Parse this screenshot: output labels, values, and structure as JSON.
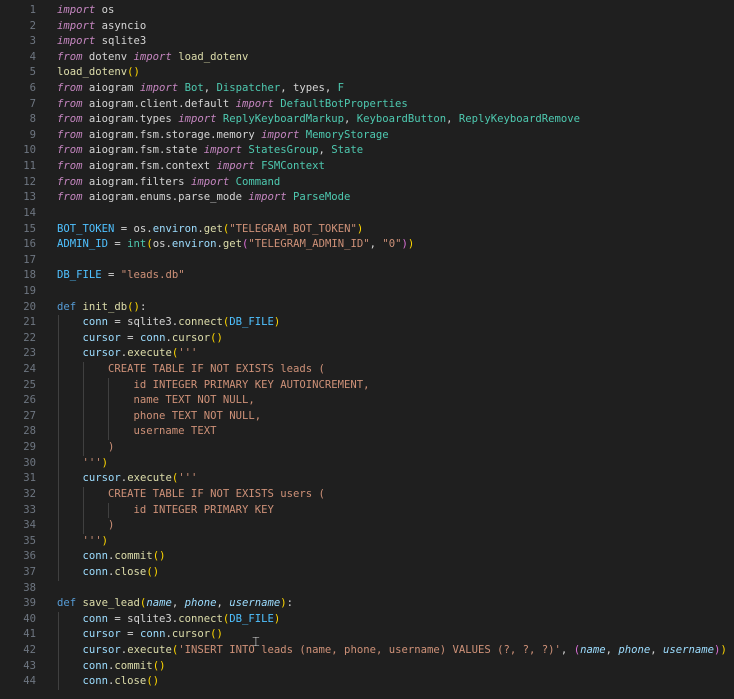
{
  "editor": {
    "language": "python",
    "colors": {
      "background": "#1f1f1f",
      "line_number": "#6e7681",
      "keyword": "#c586c0",
      "function": "#dcdcaa",
      "string": "#ce9178",
      "variable": "#9cdcfe",
      "class": "#4ec9b0"
    },
    "lines": [
      {
        "n": "1",
        "tokens": [
          [
            "kw",
            "import"
          ],
          [
            "p",
            " os"
          ]
        ]
      },
      {
        "n": "2",
        "tokens": [
          [
            "kw",
            "import"
          ],
          [
            "p",
            " asyncio"
          ]
        ]
      },
      {
        "n": "3",
        "tokens": [
          [
            "kw",
            "import"
          ],
          [
            "p",
            " sqlite3"
          ]
        ]
      },
      {
        "n": "4",
        "tokens": [
          [
            "kw",
            "from"
          ],
          [
            "p",
            " dotenv "
          ],
          [
            "kw",
            "import"
          ],
          [
            "fn",
            " load_dotenv"
          ]
        ]
      },
      {
        "n": "5",
        "tokens": [
          [
            "fn",
            "load_dotenv"
          ],
          [
            "b1",
            "()"
          ]
        ]
      },
      {
        "n": "6",
        "tokens": [
          [
            "kw",
            "from"
          ],
          [
            "p",
            " aiogram "
          ],
          [
            "kw",
            "import"
          ],
          [
            "cls",
            " Bot"
          ],
          [
            "p",
            ", "
          ],
          [
            "cls",
            "Dispatcher"
          ],
          [
            "p",
            ", types, "
          ],
          [
            "cls",
            "F"
          ]
        ]
      },
      {
        "n": "7",
        "tokens": [
          [
            "kw",
            "from"
          ],
          [
            "p",
            " aiogram.client.default "
          ],
          [
            "kw",
            "import"
          ],
          [
            "cls",
            " DefaultBotProperties"
          ]
        ]
      },
      {
        "n": "8",
        "tokens": [
          [
            "kw",
            "from"
          ],
          [
            "p",
            " aiogram.types "
          ],
          [
            "kw",
            "import"
          ],
          [
            "cls",
            " ReplyKeyboardMarkup"
          ],
          [
            "p",
            ", "
          ],
          [
            "cls",
            "KeyboardButton"
          ],
          [
            "p",
            ", "
          ],
          [
            "cls",
            "ReplyKeyboardRemove"
          ]
        ]
      },
      {
        "n": "9",
        "tokens": [
          [
            "kw",
            "from"
          ],
          [
            "p",
            " aiogram.fsm.storage.memory "
          ],
          [
            "kw",
            "import"
          ],
          [
            "cls",
            " MemoryStorage"
          ]
        ]
      },
      {
        "n": "10",
        "tokens": [
          [
            "kw",
            "from"
          ],
          [
            "p",
            " aiogram.fsm.state "
          ],
          [
            "kw",
            "import"
          ],
          [
            "cls",
            " StatesGroup"
          ],
          [
            "p",
            ", "
          ],
          [
            "cls",
            "State"
          ]
        ]
      },
      {
        "n": "11",
        "tokens": [
          [
            "kw",
            "from"
          ],
          [
            "p",
            " aiogram.fsm.context "
          ],
          [
            "kw",
            "import"
          ],
          [
            "cls",
            " FSMContext"
          ]
        ]
      },
      {
        "n": "12",
        "tokens": [
          [
            "kw",
            "from"
          ],
          [
            "p",
            " aiogram.filters "
          ],
          [
            "kw",
            "import"
          ],
          [
            "cls",
            " Command"
          ]
        ]
      },
      {
        "n": "13",
        "tokens": [
          [
            "kw",
            "from"
          ],
          [
            "p",
            " aiogram.enums.parse_mode "
          ],
          [
            "kw",
            "import"
          ],
          [
            "cls",
            " ParseMode"
          ]
        ]
      },
      {
        "n": "14",
        "tokens": []
      },
      {
        "n": "15",
        "tokens": [
          [
            "const",
            "BOT_TOKEN"
          ],
          [
            "p",
            " = os."
          ],
          [
            "var",
            "environ"
          ],
          [
            "p",
            "."
          ],
          [
            "fn",
            "get"
          ],
          [
            "b1",
            "("
          ],
          [
            "str",
            "\"TELEGRAM_BOT_TOKEN\""
          ],
          [
            "b1",
            ")"
          ]
        ]
      },
      {
        "n": "16",
        "tokens": [
          [
            "const",
            "ADMIN_ID"
          ],
          [
            "p",
            " = "
          ],
          [
            "cls",
            "int"
          ],
          [
            "b1",
            "("
          ],
          [
            "p",
            "os."
          ],
          [
            "var",
            "environ"
          ],
          [
            "p",
            "."
          ],
          [
            "fn",
            "get"
          ],
          [
            "b2",
            "("
          ],
          [
            "str",
            "\"TELEGRAM_ADMIN_ID\""
          ],
          [
            "p",
            ", "
          ],
          [
            "str",
            "\"0\""
          ],
          [
            "b2",
            ")"
          ],
          [
            "b1",
            ")"
          ]
        ]
      },
      {
        "n": "17",
        "tokens": []
      },
      {
        "n": "18",
        "tokens": [
          [
            "const",
            "DB_FILE"
          ],
          [
            "p",
            " = "
          ],
          [
            "str",
            "\"leads.db\""
          ]
        ]
      },
      {
        "n": "19",
        "tokens": []
      },
      {
        "n": "20",
        "tokens": [
          [
            "def",
            "def"
          ],
          [
            "fn",
            " init_db"
          ],
          [
            "b1",
            "()"
          ],
          [
            "p",
            ":"
          ]
        ]
      },
      {
        "n": "21",
        "tokens": [
          [
            "p",
            "    "
          ],
          [
            "var",
            "conn"
          ],
          [
            "p",
            " = sqlite3."
          ],
          [
            "fn",
            "connect"
          ],
          [
            "b1",
            "("
          ],
          [
            "const",
            "DB_FILE"
          ],
          [
            "b1",
            ")"
          ]
        ]
      },
      {
        "n": "22",
        "tokens": [
          [
            "p",
            "    "
          ],
          [
            "var",
            "cursor"
          ],
          [
            "p",
            " = "
          ],
          [
            "var",
            "conn"
          ],
          [
            "p",
            "."
          ],
          [
            "fn",
            "cursor"
          ],
          [
            "b1",
            "()"
          ]
        ]
      },
      {
        "n": "23",
        "tokens": [
          [
            "p",
            "    "
          ],
          [
            "var",
            "cursor"
          ],
          [
            "p",
            "."
          ],
          [
            "fn",
            "execute"
          ],
          [
            "b1",
            "("
          ],
          [
            "str",
            "'''"
          ]
        ]
      },
      {
        "n": "24",
        "tokens": [
          [
            "str",
            "        CREATE TABLE IF NOT EXISTS leads ("
          ]
        ]
      },
      {
        "n": "25",
        "tokens": [
          [
            "str",
            "            id INTEGER PRIMARY KEY AUTOINCREMENT,"
          ]
        ]
      },
      {
        "n": "26",
        "tokens": [
          [
            "str",
            "            name TEXT NOT NULL,"
          ]
        ]
      },
      {
        "n": "27",
        "tokens": [
          [
            "str",
            "            phone TEXT NOT NULL,"
          ]
        ]
      },
      {
        "n": "28",
        "tokens": [
          [
            "str",
            "            username TEXT"
          ]
        ]
      },
      {
        "n": "29",
        "tokens": [
          [
            "str",
            "        )"
          ]
        ]
      },
      {
        "n": "30",
        "tokens": [
          [
            "str",
            "    '''"
          ],
          [
            "b1",
            ")"
          ]
        ]
      },
      {
        "n": "31",
        "tokens": [
          [
            "p",
            "    "
          ],
          [
            "var",
            "cursor"
          ],
          [
            "p",
            "."
          ],
          [
            "fn",
            "execute"
          ],
          [
            "b1",
            "("
          ],
          [
            "str",
            "'''"
          ]
        ]
      },
      {
        "n": "32",
        "tokens": [
          [
            "str",
            "        CREATE TABLE IF NOT EXISTS users ("
          ]
        ]
      },
      {
        "n": "33",
        "tokens": [
          [
            "str",
            "            id INTEGER PRIMARY KEY"
          ]
        ]
      },
      {
        "n": "34",
        "tokens": [
          [
            "str",
            "        )"
          ]
        ]
      },
      {
        "n": "35",
        "tokens": [
          [
            "str",
            "    '''"
          ],
          [
            "b1",
            ")"
          ]
        ]
      },
      {
        "n": "36",
        "tokens": [
          [
            "p",
            "    "
          ],
          [
            "var",
            "conn"
          ],
          [
            "p",
            "."
          ],
          [
            "fn",
            "commit"
          ],
          [
            "b1",
            "()"
          ]
        ]
      },
      {
        "n": "37",
        "tokens": [
          [
            "p",
            "    "
          ],
          [
            "var",
            "conn"
          ],
          [
            "p",
            "."
          ],
          [
            "fn",
            "close"
          ],
          [
            "b1",
            "()"
          ]
        ]
      },
      {
        "n": "38",
        "tokens": []
      },
      {
        "n": "39",
        "tokens": [
          [
            "def",
            "def"
          ],
          [
            "fn",
            " save_lead"
          ],
          [
            "b1",
            "("
          ],
          [
            "prm",
            "name"
          ],
          [
            "p",
            ", "
          ],
          [
            "prm",
            "phone"
          ],
          [
            "p",
            ", "
          ],
          [
            "prm",
            "username"
          ],
          [
            "b1",
            ")"
          ],
          [
            "p",
            ":"
          ]
        ]
      },
      {
        "n": "40",
        "tokens": [
          [
            "p",
            "    "
          ],
          [
            "var",
            "conn"
          ],
          [
            "p",
            " = sqlite3."
          ],
          [
            "fn",
            "connect"
          ],
          [
            "b1",
            "("
          ],
          [
            "const",
            "DB_FILE"
          ],
          [
            "b1",
            ")"
          ]
        ]
      },
      {
        "n": "41",
        "tokens": [
          [
            "p",
            "    "
          ],
          [
            "var",
            "cursor"
          ],
          [
            "p",
            " = "
          ],
          [
            "var",
            "conn"
          ],
          [
            "p",
            "."
          ],
          [
            "fn",
            "cursor"
          ],
          [
            "b1",
            "()"
          ]
        ]
      },
      {
        "n": "42",
        "tokens": [
          [
            "p",
            "    "
          ],
          [
            "var",
            "cursor"
          ],
          [
            "p",
            "."
          ],
          [
            "fn",
            "execute"
          ],
          [
            "b1",
            "("
          ],
          [
            "str",
            "'INSERT INTO leads (name, phone, username) VALUES (?, ?, ?)'"
          ],
          [
            "p",
            ", "
          ],
          [
            "b2",
            "("
          ],
          [
            "prm",
            "name"
          ],
          [
            "p",
            ", "
          ],
          [
            "prm",
            "phone"
          ],
          [
            "p",
            ", "
          ],
          [
            "prm",
            "username"
          ],
          [
            "b2",
            ")"
          ],
          [
            "b1",
            ")"
          ]
        ]
      },
      {
        "n": "43",
        "tokens": [
          [
            "p",
            "    "
          ],
          [
            "var",
            "conn"
          ],
          [
            "p",
            "."
          ],
          [
            "fn",
            "commit"
          ],
          [
            "b1",
            "()"
          ]
        ]
      },
      {
        "n": "44",
        "tokens": [
          [
            "p",
            "    "
          ],
          [
            "var",
            "conn"
          ],
          [
            "p",
            "."
          ],
          [
            "fn",
            "close"
          ],
          [
            "b1",
            "()"
          ]
        ]
      }
    ]
  }
}
